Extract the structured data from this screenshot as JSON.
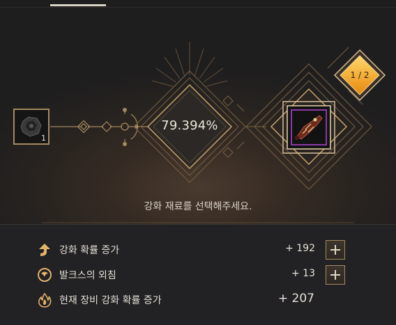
{
  "material": {
    "count": "1"
  },
  "success_rate": "79.394%",
  "enhance_stage": "1 / 2",
  "guide_text": "강화 재료를 선택해주세요.",
  "bonuses": [
    {
      "label": "강화 확률 증가",
      "value": "+ 192",
      "icon": "up-arrow-icon"
    },
    {
      "label": "발크스의 외침",
      "value": "+ 13",
      "icon": "valks-cry-icon"
    },
    {
      "label": "현재 장비 강화 확률 증가",
      "value": "+ 207",
      "icon": "flame-icon"
    }
  ],
  "colors": {
    "gold": "#c9a46a",
    "accent": "#f0a21c",
    "text": "#e6e1d8"
  }
}
